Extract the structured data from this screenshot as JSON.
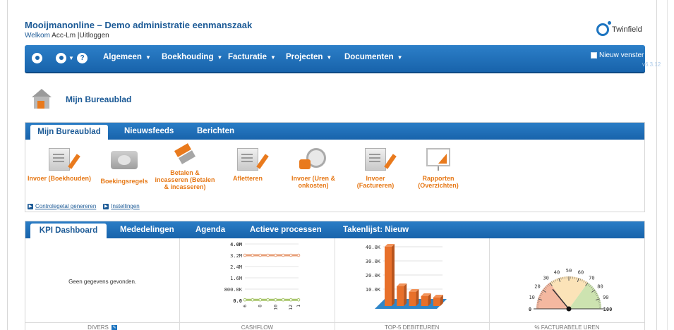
{
  "header": {
    "app_title": "Mooijmanonline – Demo administratie eenmanszaak",
    "welcome_prefix": "Welkom",
    "user": "Acc-Lm",
    "separator": "|",
    "logout": "Uitloggen",
    "brand_name": "Twinfield"
  },
  "navbar": {
    "menus": [
      {
        "label": "Algemeen"
      },
      {
        "label": "Boekhouding"
      },
      {
        "label": "Facturatie"
      },
      {
        "label": "Projecten"
      },
      {
        "label": "Documenten"
      }
    ],
    "help_icon": "?",
    "new_window_label": "Nieuw venster",
    "version": "v6.3.12"
  },
  "page": {
    "heading": "Mijn Bureaublad"
  },
  "top_panel": {
    "tabs": [
      {
        "label": "Mijn Bureaublad",
        "active": true
      },
      {
        "label": "Nieuwsfeeds",
        "active": false
      },
      {
        "label": "Berichten",
        "active": false
      }
    ],
    "tiles": [
      {
        "label": "Invoer (Boekhouden)",
        "icon": "invoice-pencil-icon"
      },
      {
        "label": "Boekingsregels",
        "icon": "cash-icon"
      },
      {
        "label": "Betalen & incasseren (Betalen & incasseren)",
        "icon": "transfer-arrows-icon"
      },
      {
        "label": "Afletteren",
        "icon": "checklist-icon"
      },
      {
        "label": "Invoer (Uren & onkosten)",
        "icon": "clock-coins-icon"
      },
      {
        "label": "Invoer (Factureren)",
        "icon": "invoice-pencil-icon"
      },
      {
        "label": "Rapporten (Overzichten)",
        "icon": "presentation-chart-icon"
      }
    ],
    "links": [
      {
        "label": "Controlegetal genereren"
      },
      {
        "label": "Instellingen"
      }
    ]
  },
  "kpi_panel": {
    "tabs": [
      {
        "label": "KPI Dashboard",
        "active": true
      },
      {
        "label": "Mededelingen",
        "active": false
      },
      {
        "label": "Agenda",
        "active": false
      },
      {
        "label": "Actieve processen",
        "active": false
      },
      {
        "label": "Takenlijst: Nieuw",
        "active": false
      }
    ],
    "widgets": {
      "divers": {
        "title": "DIVERS",
        "message": "Geen gegevens gevonden."
      },
      "cashflow": {
        "title": "CASHFLOW"
      },
      "top5": {
        "title": "TOP-5 DEBITEUREN"
      },
      "gauge": {
        "title": "% FACTURABELE UREN"
      }
    }
  },
  "chart_data": [
    {
      "type": "line",
      "name": "cashflow",
      "y_tick_labels": [
        "0.0",
        "800.0K",
        "1.6M",
        "2.4M",
        "3.2M",
        "4.0M"
      ],
      "ylim": [
        0,
        4000000
      ],
      "x": [
        6,
        7,
        8,
        9,
        10,
        11,
        12,
        1
      ],
      "series": [
        {
          "values": [
            3200000,
            3200000,
            3200000,
            3200000,
            3200000,
            3200000,
            3200000,
            3200000
          ],
          "color": "#e8a07a"
        },
        {
          "values": [
            40000,
            40000,
            40000,
            40000,
            40000,
            40000,
            40000,
            40000
          ],
          "color": "#a8c66c"
        }
      ],
      "x_tick_labels": [
        "6",
        "8",
        "10",
        "12",
        "1"
      ]
    },
    {
      "type": "bar",
      "name": "top5-debiteuren",
      "y_tick_labels": [
        "10.0K",
        "20.0K",
        "30.0K",
        "40.0K"
      ],
      "ylim": [
        0,
        40000
      ],
      "categories": [
        "1",
        "2",
        "3",
        "4",
        "5"
      ],
      "values": [
        40000,
        12000,
        8000,
        5000,
        4000
      ],
      "colors": {
        "bar": "#e8702a",
        "base": "#2f86c9"
      }
    },
    {
      "type": "gauge",
      "name": "facturabele-uren",
      "min": 0,
      "max": 100,
      "value": 28,
      "tick_labels": [
        "0",
        "10",
        "20",
        "30",
        "40",
        "50",
        "60",
        "70",
        "80",
        "90",
        "100"
      ],
      "bands": [
        {
          "from": 0,
          "to": 30,
          "color": "#f4b8a0"
        },
        {
          "from": 30,
          "to": 70,
          "color": "#fbe3b8"
        },
        {
          "from": 70,
          "to": 100,
          "color": "#cde3b0"
        }
      ]
    }
  ]
}
